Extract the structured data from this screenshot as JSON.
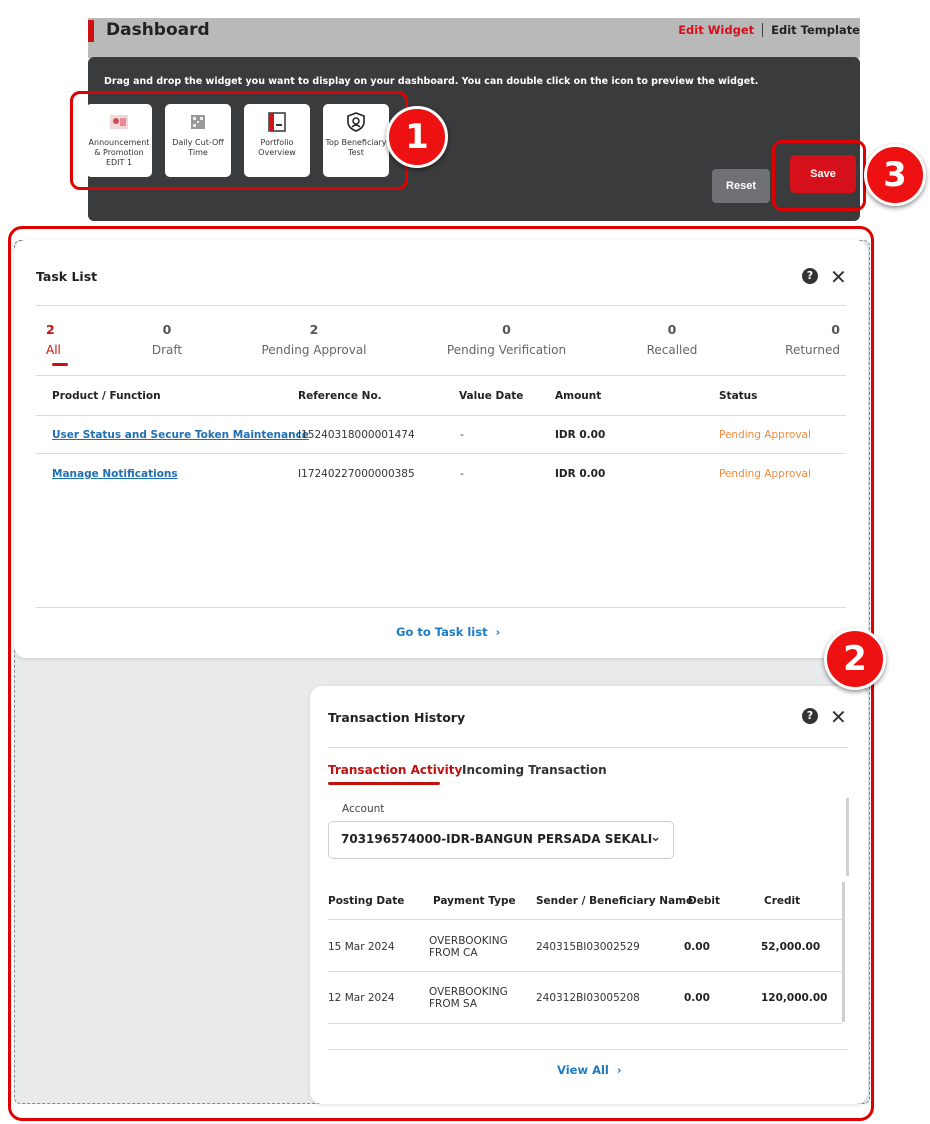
{
  "header": {
    "title": "Dashboard",
    "edit_widget": "Edit Widget",
    "edit_template": "Edit Template"
  },
  "widget_panel": {
    "instruction": "Drag and drop the widget you want to display on your dashboard. You can double click on the icon to preview the widget.",
    "tiles": [
      {
        "label": "Announcement & Promotion EDIT 1",
        "icon": "image-thumbnail-icon"
      },
      {
        "label": "Daily Cut-Off Time",
        "icon": "qr-grid-icon"
      },
      {
        "label": "Portfolio Overview",
        "icon": "portfolio-doc-icon"
      },
      {
        "label": "Top Beneficiary Test",
        "icon": "user-shield-icon"
      }
    ],
    "reset_label": "Reset",
    "save_label": "Save"
  },
  "annotations": {
    "badge1": "1",
    "badge2": "2",
    "badge3": "3"
  },
  "task_list": {
    "title": "Task List",
    "help": "?",
    "close": "✕",
    "stats": [
      {
        "count": "2",
        "label": "All"
      },
      {
        "count": "0",
        "label": "Draft"
      },
      {
        "count": "2",
        "label": "Pending Approval"
      },
      {
        "count": "0",
        "label": "Pending Verification"
      },
      {
        "count": "0",
        "label": "Recalled"
      },
      {
        "count": "0",
        "label": "Returned"
      }
    ],
    "columns": [
      "Product / Function",
      "Reference No.",
      "Value Date",
      "Amount",
      "Status"
    ],
    "rows": [
      {
        "product": "User Status and Secure Token Maintenance",
        "ref": "I15240318000001474",
        "value_date": "-",
        "amount": "IDR 0.00",
        "status": "Pending Approval"
      },
      {
        "product": "Manage Notifications",
        "ref": "I17240227000000385",
        "value_date": "-",
        "amount": "IDR 0.00",
        "status": "Pending Approval"
      }
    ],
    "go_to": "Go to Task list"
  },
  "transaction_history": {
    "title": "Transaction History",
    "help": "?",
    "close": "✕",
    "tabs": [
      "Transaction Activity",
      "Incoming Transaction"
    ],
    "account_label": "Account",
    "account_value": "703196574000-IDR-BANGUN PERSADA SEKALI",
    "columns": [
      "Posting Date",
      "Payment Type",
      "Sender / Beneficiary Name",
      "Debit",
      "Credit"
    ],
    "rows": [
      {
        "date": "15 Mar 2024",
        "type_line1": "OVERBOOKING",
        "type_line2": "FROM CA",
        "name": "240315BI03002529",
        "debit": "0.00",
        "credit": "52,000.00"
      },
      {
        "date": "12 Mar 2024",
        "type_line1": "OVERBOOKING",
        "type_line2": "FROM SA",
        "name": "240312BI03005208",
        "debit": "0.00",
        "credit": "120,000.00"
      }
    ],
    "view_all": "View All"
  },
  "colors": {
    "brand_red": "#d6101a",
    "link_blue": "#1f6fb4",
    "status_orange": "#f08a3c",
    "panel_dark": "#3a3b3d"
  }
}
